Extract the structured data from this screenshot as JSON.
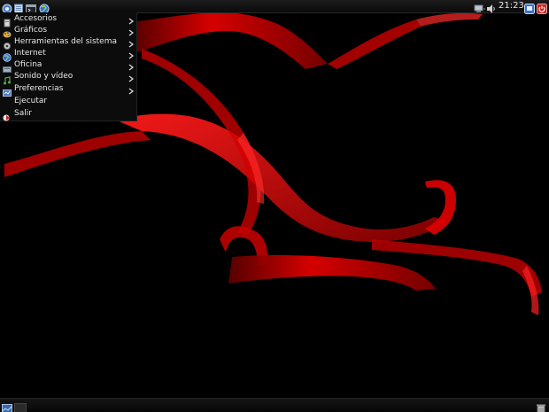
{
  "top_panel": {
    "launchers": [
      {
        "icon": "application-menu-icon"
      },
      {
        "icon": "file-manager-icon"
      },
      {
        "icon": "terminal-icon"
      },
      {
        "icon": "web-browser-icon"
      }
    ],
    "tray": [
      {
        "icon": "network-icon"
      },
      {
        "icon": "volume-icon"
      }
    ],
    "clock": "21:23",
    "right_icons": [
      {
        "icon": "screen-lock-icon"
      },
      {
        "icon": "power-icon"
      }
    ]
  },
  "app_menu": {
    "items": [
      {
        "label": "Accesorios",
        "icon": "accessories-icon",
        "submenu": true
      },
      {
        "label": "Gráficos",
        "icon": "graphics-icon",
        "submenu": true
      },
      {
        "label": "Herramientas del sistema",
        "icon": "system-tools-icon",
        "submenu": true
      },
      {
        "label": "Internet",
        "icon": "internet-icon",
        "submenu": true
      },
      {
        "label": "Oficina",
        "icon": "office-icon",
        "submenu": true
      },
      {
        "label": "Sonido y vídeo",
        "icon": "sound-video-icon",
        "submenu": true
      },
      {
        "label": "Preferencias",
        "icon": "preferences-icon",
        "submenu": true
      },
      {
        "label": "Ejecutar",
        "icon": "",
        "submenu": false
      },
      {
        "label": "Salir",
        "icon": "logout-icon",
        "submenu": false
      }
    ]
  },
  "bottom_panel": {
    "left_icons": [
      {
        "icon": "show-desktop-icon"
      },
      {
        "icon": "workspace-switcher-icon"
      }
    ],
    "right_icons": [
      {
        "icon": "trash-icon"
      }
    ]
  },
  "colors": {
    "wallpaper_background": "#000000",
    "ribbon_red": "#e00000",
    "menu_background": "#0c0c0c",
    "panel_background": "#111111",
    "text": "#e8e8e8"
  }
}
